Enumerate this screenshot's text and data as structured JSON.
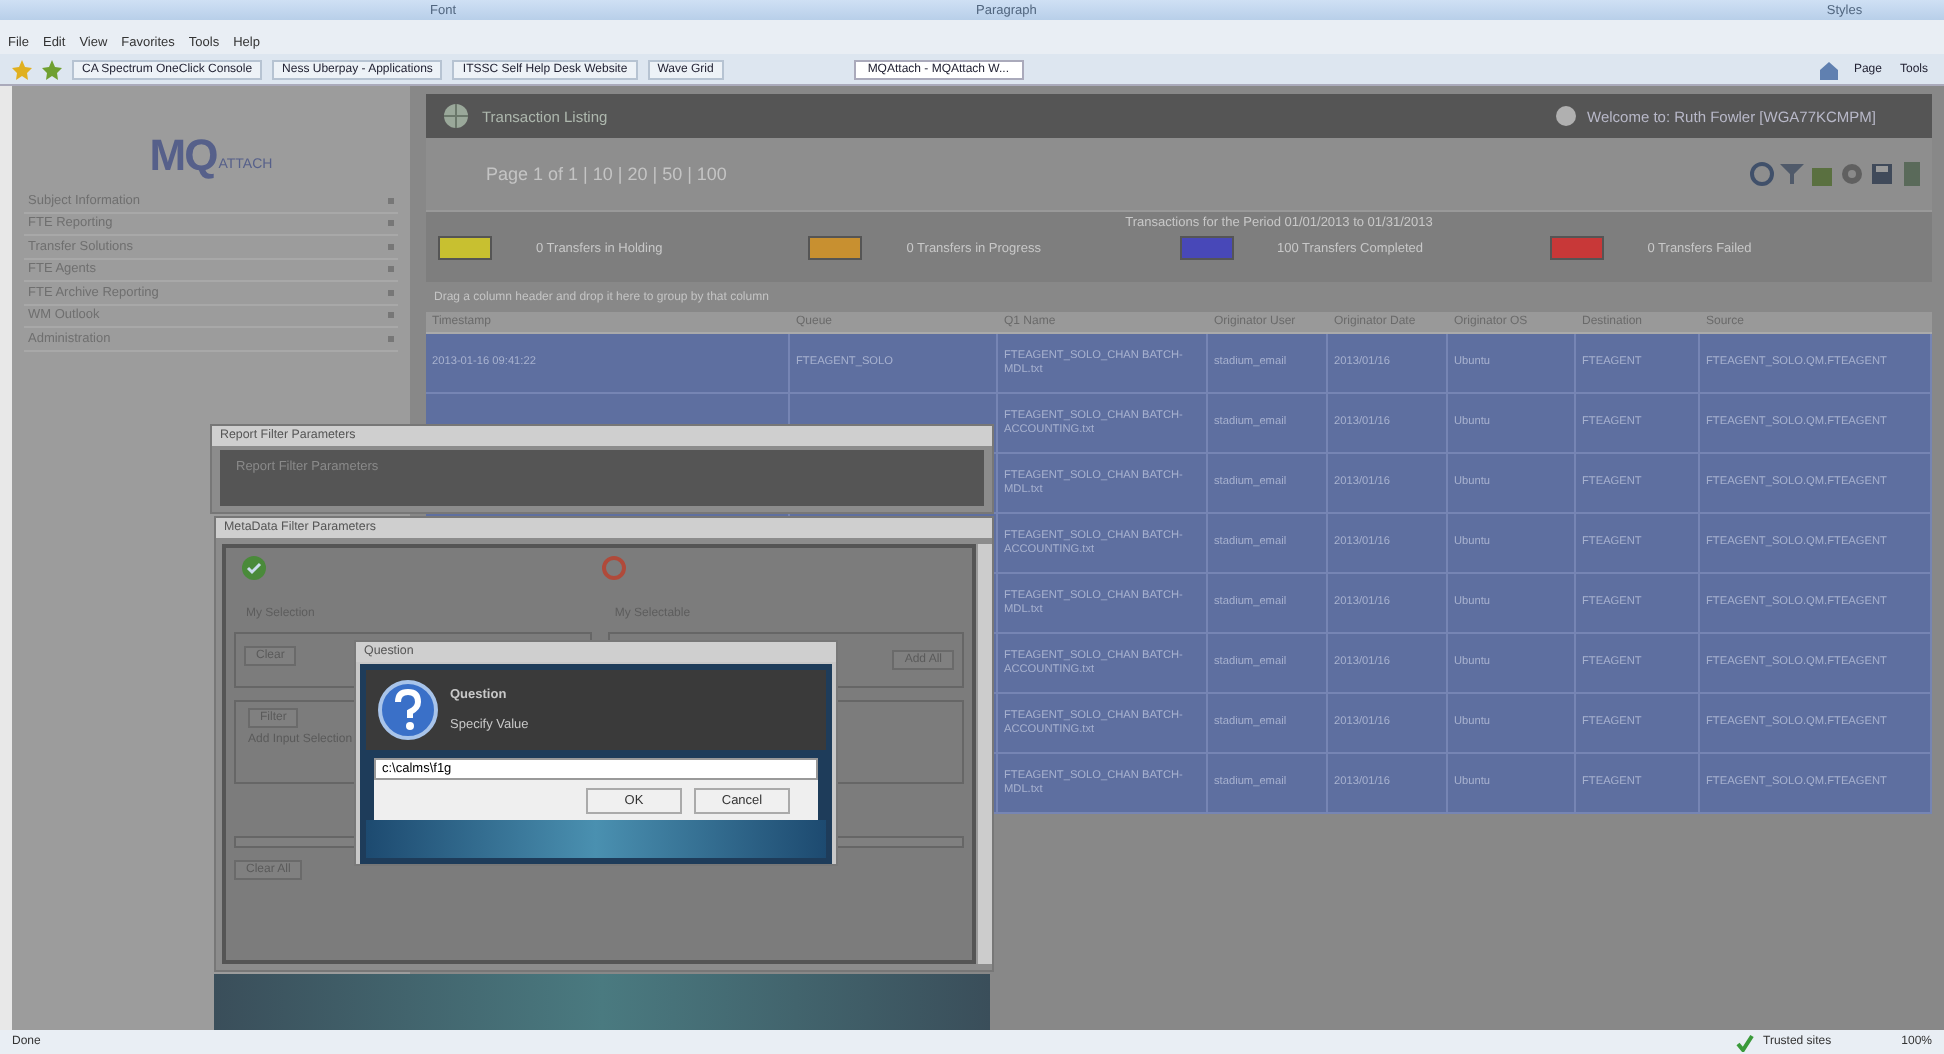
{
  "ribbon": {
    "groups": [
      "Font",
      "Paragraph",
      "Styles"
    ]
  },
  "browser": {
    "menus": [
      "File",
      "Edit",
      "View",
      "Favorites",
      "Tools",
      "Help"
    ],
    "favorites": [
      "CA Spectrum OneClick Console",
      "Ness Uberpay - Applications",
      "ITSSC Self Help Desk Website",
      "Wave Grid"
    ],
    "tabs": [
      {
        "label": "MQAttach - MQAttach W...",
        "selected": true
      }
    ],
    "tools": [
      "Page",
      "Tools"
    ]
  },
  "app": {
    "logo": "MQ",
    "logo_sub": "ATTACH",
    "sidebar": {
      "items": [
        "Subject Information",
        "FTE Reporting",
        "Transfer Solutions",
        "FTE Agents",
        "FTE Archive Reporting",
        "WM Outlook",
        "Administration"
      ]
    },
    "header": {
      "title": "Transaction Listing",
      "welcome": "Welcome to: Ruth Fowler [WGA77KCMPM]"
    },
    "pager": "Page 1 of 1 | 10 | 20 | 50 | 100",
    "period": "Transactions for the Period 01/01/2013 to 01/31/2013",
    "legend": [
      {
        "label": "0 Transfers in Holding",
        "color": "#c8c030"
      },
      {
        "label": "0 Transfers in Progress",
        "color": "#c89030"
      },
      {
        "label": "100 Transfers Completed",
        "color": "#4848b8"
      },
      {
        "label": "0 Transfers Failed",
        "color": "#c83838"
      }
    ],
    "hint": "Drag a column header and drop it here to group by that column",
    "table": {
      "columns": [
        "Timestamp",
        "Queue",
        "Q1 Name",
        "Originator User",
        "Originator Date",
        "Originator OS",
        "Destination",
        "Source"
      ],
      "rows": [
        {
          "cells": [
            "2013-01-16 09:41:22",
            "FTEAGENT_SOLO",
            "FTEAGENT_SOLO_CHAN BATCH-MDL.txt",
            "stadium_email",
            "2013/01/16",
            "Ubuntu",
            "FTEAGENT",
            "FTEAGENT_SOLO.QM.FTEAGENT"
          ]
        },
        {
          "cells": [
            "FTEAGENT_SOLO_CHAN BATCH-ACCOUNTING.txt",
            "stadium_email",
            "2013/01/16",
            "Ubuntu",
            "FTEAGENT",
            "FTEAGENT_SOLO.QM.FTEAGENT"
          ]
        },
        {
          "cells": [
            "FTEAGENT_SOLO_CHAN BATCH-MDL.txt",
            "stadium_email",
            "2013/01/16",
            "Ubuntu",
            "FTEAGENT",
            "FTEAGENT_SOLO.QM.FTEAGENT"
          ]
        },
        {
          "cells": [
            "FTEAGENT_SOLO_CHAN BATCH-ACCOUNTING.txt",
            "stadium_email",
            "2013/01/16",
            "Ubuntu",
            "FTEAGENT",
            "FTEAGENT_SOLO.QM.FTEAGENT"
          ]
        },
        {
          "cells": [
            "FTEAGENT_SOLO_CHAN BATCH-MDL.txt",
            "stadium_email",
            "2013/01/16",
            "Ubuntu",
            "FTEAGENT",
            "FTEAGENT_SOLO.QM.FTEAGENT"
          ]
        },
        {
          "cells": [
            "FTEAGENT_SOLO_CHAN BATCH-ACCOUNTING.txt",
            "stadium_email",
            "2013/01/16",
            "Ubuntu",
            "FTEAGENT",
            "FTEAGENT_SOLO.QM.FTEAGENT"
          ]
        },
        {
          "cells": [
            "FTEAGENT_SOLO_CHAN BATCH-ACCOUNTING.txt",
            "stadium_email",
            "2013/01/16",
            "Ubuntu",
            "FTEAGENT",
            "FTEAGENT_SOLO.QM.FTEAGENT"
          ]
        },
        {
          "cells": [
            "FTEAGENT_SOLO_CHAN BATCH-MDL.txt",
            "stadium_email",
            "2013/01/16",
            "Ubuntu",
            "FTEAGENT",
            "FTEAGENT_SOLO.QM.FTEAGENT"
          ]
        }
      ]
    }
  },
  "dialogs": {
    "report_filter": {
      "title": "Report Filter Parameters",
      "heading": "Report Filter Parameters"
    },
    "metadata_filter": {
      "title": "MetaData Filter Parameters",
      "left_label": "My Selection",
      "right_label": "My Selectable",
      "left_button": "Clear",
      "right_button": "Add All",
      "filter_label": "Filter",
      "filter_text": "Add Input Selection",
      "bottom_button": "Clear All"
    },
    "question": {
      "title": "Question",
      "heading": "Question",
      "prompt": "Specify Value",
      "value": "c:\\calms\\f1g",
      "buttons": [
        "OK",
        "Cancel"
      ]
    }
  },
  "status_bar": {
    "left": "Done",
    "zone": "Trusted sites",
    "zoom": "100%"
  }
}
